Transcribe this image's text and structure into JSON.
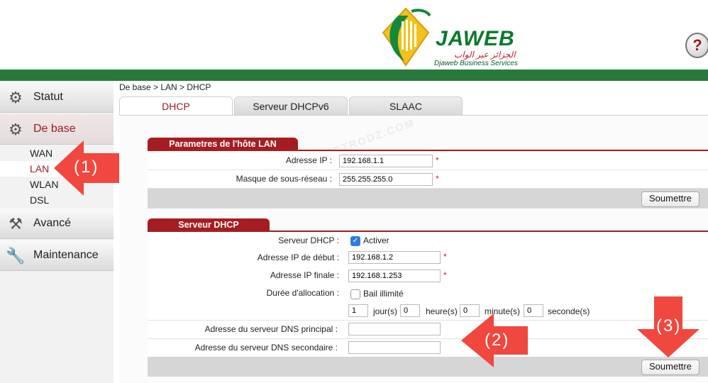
{
  "header": {
    "brand_name": "JAWEB",
    "brand_arabic": "الجزائر عبر الواب",
    "brand_sub": "Djaweb Business Services",
    "help_glyph": "?",
    "accent_color": "#277a3b"
  },
  "sidebar": {
    "items": [
      {
        "label": "Statut",
        "icon": "status-icon"
      },
      {
        "label": "De base",
        "icon": "gear-icon"
      },
      {
        "label": "Avancé",
        "icon": "tools-icon"
      },
      {
        "label": "Maintenance",
        "icon": "wrench-icon"
      }
    ],
    "subitems": [
      {
        "label": "WAN"
      },
      {
        "label": "LAN",
        "selected": true
      },
      {
        "label": "WLAN"
      },
      {
        "label": "DSL"
      }
    ]
  },
  "breadcrumb": "De base > LAN > DHCP",
  "tabs": [
    {
      "label": "DHCP",
      "active": true
    },
    {
      "label": "Serveur DHCPv6"
    },
    {
      "label": "SLAAC"
    }
  ],
  "watermark": "WWW.ELECTRODZ.COM",
  "lan_section": {
    "title": "Parametres de l'hôte LAN",
    "ip_label": "Adresse IP :",
    "ip_value": "192.168.1.1",
    "mask_label": "Masque de sous-réseau :",
    "mask_value": "255.255.255.0",
    "required": "*",
    "submit_label": "Soumettre"
  },
  "dhcp_section": {
    "title": "Serveur DHCP",
    "server_label": "Serveur DHCP :",
    "server_option": "Activer",
    "server_checked": true,
    "start_label": "Adresse IP de début :",
    "start_value": "192.168.1.2",
    "end_label": "Adresse IP finale :",
    "end_value": "192.168.1.253",
    "lease_label": "Durée d'allocation :",
    "lease_option": "Bail illimité",
    "lease_checked": false,
    "days_value": "1",
    "days_unit": "jour(s)",
    "hours_value": "0",
    "hours_unit": "heure(s)",
    "minutes_value": "0",
    "minutes_unit": "minute(s)",
    "seconds_value": "0",
    "seconds_unit": "seconde(s)",
    "dns1_label": "Adresse du serveur DNS principal :",
    "dns1_value": "",
    "dns2_label": "Adresse du serveur DNS secondaire :",
    "dns2_value": "",
    "required": "*",
    "submit_label": "Soumettre"
  },
  "callouts": [
    "(1)",
    "(2)",
    "(3)"
  ],
  "callout_color": "#f0473f"
}
